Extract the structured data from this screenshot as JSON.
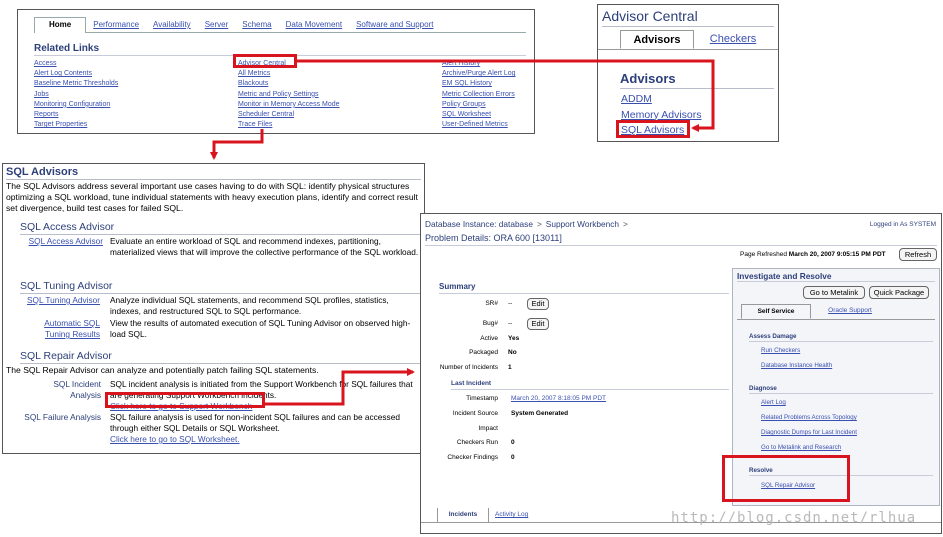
{
  "panel1": {
    "tabs": [
      "Home",
      "Performance",
      "Availability",
      "Server",
      "Schema",
      "Data Movement",
      "Software and Support"
    ],
    "section_title": "Related Links",
    "col1": [
      "Access",
      "Alert Log Contents",
      "Baseline Metric Thresholds",
      "Jobs",
      "Monitoring Configuration",
      "Reports",
      "Target Properties"
    ],
    "col2": [
      "Advisor Central",
      "All Metrics",
      "Blackouts",
      "Metric and Policy Settings",
      "Monitor in Memory Access Mode",
      "Scheduler Central",
      "Trace Files"
    ],
    "col3": [
      "Alert History",
      "Archive/Purge Alert Log",
      "EM SQL History",
      "Metric Collection Errors",
      "Policy Groups",
      "SQL Worksheet",
      "User-Defined Metrics"
    ]
  },
  "panel2": {
    "title": "Advisor Central",
    "tab_advisors": "Advisors",
    "tab_checkers": "Checkers",
    "subtitle": "Advisors",
    "links": [
      "ADDM",
      "Memory Advisors",
      "SQL Advisors"
    ]
  },
  "panel3": {
    "title": "SQL Advisors",
    "intro": "The SQL Advisors address several important use cases having to do with SQL: identify physical structures optimizing a SQL workload, tune individual statements with heavy execution plans, identify and correct result set divergence, build test cases for failed SQL.",
    "access": {
      "heading": "SQL Access Advisor",
      "link": "SQL Access Advisor",
      "text": "Evaluate an entire workload of SQL and recommend indexes, partitioning, materialized views that will improve the collective performance of the SQL workload."
    },
    "tuning": {
      "heading": "SQL Tuning Advisor",
      "link1": "SQL Tuning Advisor",
      "text1": "Analyze individual SQL statements, and recommend SQL profiles, statistics, indexes, and restructured SQL to SQL performance.",
      "link2a": "Automatic SQL",
      "link2b": "Tuning Results",
      "text2": "View the results of automated execution of SQL Tuning Advisor on observed high-load SQL."
    },
    "repair": {
      "heading": "SQL Repair Advisor",
      "intro": "The SQL Repair Advisor can analyze and potentially patch failing SQL statements.",
      "label1a": "SQL Incident",
      "label1b": "Analysis",
      "text1": "SQL incident analysis is initiated from the Support Workbench for SQL failures that are generating Support Workbench incidents.",
      "link1": "Click here to go to Support Workbench",
      "label2": "SQL Failure Analysis",
      "text2": "SQL failure analysis is used for non-incident SQL failures and can be accessed through either SQL Details or SQL Worksheet.",
      "link2": "Click here to go to SQL Worksheet."
    }
  },
  "panel4": {
    "breadcrumb": [
      "Database Instance: database",
      "Support Workbench"
    ],
    "logged_in": "Logged in As SYSTEM",
    "title": "Problem Details: ORA 600 [13011]",
    "refreshed_label": "Page Refreshed",
    "refreshed_value": "March 20, 2007 9:05:15 PM PDT",
    "refresh_button": "Refresh",
    "summary_title": "Summary",
    "summary": [
      {
        "label": "SR#",
        "value": "--",
        "button": "Edit"
      },
      {
        "label": "Bug#",
        "value": "--",
        "button": "Edit"
      },
      {
        "label": "Active",
        "value": "Yes"
      },
      {
        "label": "Packaged",
        "value": "No"
      },
      {
        "label": "Number of Incidents",
        "value": "1"
      }
    ],
    "last_incident_title": "Last Incident",
    "last_incident": [
      {
        "label": "Timestamp",
        "value": "March 20, 2007 8:18:05 PM PDT",
        "link": true
      },
      {
        "label": "Incident Source",
        "value": "System Generated"
      },
      {
        "label": "Impact",
        "value": ""
      },
      {
        "label": "Checkers Run",
        "value": "0"
      },
      {
        "label": "Checker Findings",
        "value": "0"
      }
    ],
    "investigate_title": "Investigate and Resolve",
    "btn_metalink": "Go to Metalink",
    "btn_quick": "Quick Package",
    "tab_self": "Self Service",
    "tab_oracle": "Oracle Support",
    "assess_title": "Assess Damage",
    "assess_links": [
      "Run Checkers",
      "Database Instance Health"
    ],
    "diagnose_title": "Diagnose",
    "diagnose_links": [
      "Alert Log",
      "Related Problems Across Topology",
      "Diagnostic Dumps for Last Incident",
      "Go to Metalink and Research"
    ],
    "resolve_title": "Resolve",
    "resolve_links": [
      "SQL Repair Advisor"
    ],
    "bottom_tabs": [
      "Incidents",
      "Activity Log"
    ],
    "watermark": "http://blog.csdn.net/rlhua"
  },
  "colors": {
    "highlight": "#d8141e",
    "link": "#3a50b0",
    "heading": "#2c3f7a"
  }
}
